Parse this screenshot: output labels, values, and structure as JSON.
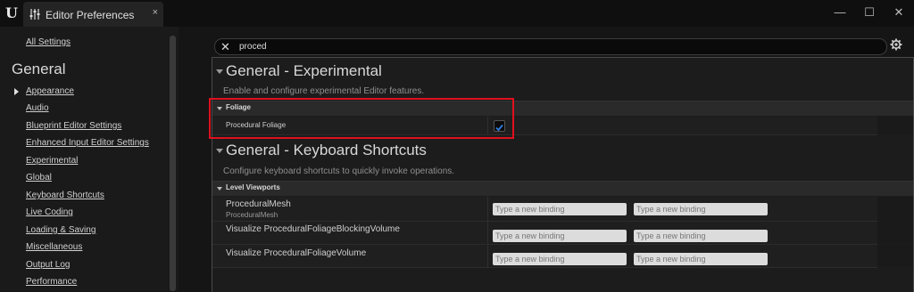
{
  "window": {
    "tab_title": "Editor Preferences",
    "tab_close": "×",
    "minimize": "—",
    "maximize": "☐",
    "close": "✕"
  },
  "sidebar": {
    "all_settings": "All Settings",
    "heading": "General",
    "items": [
      {
        "label": "Appearance",
        "active": true
      },
      {
        "label": "Audio"
      },
      {
        "label": "Blueprint Editor Settings"
      },
      {
        "label": "Enhanced Input Editor Settings"
      },
      {
        "label": "Experimental"
      },
      {
        "label": "Global"
      },
      {
        "label": "Keyboard Shortcuts"
      },
      {
        "label": "Live Coding"
      },
      {
        "label": "Loading & Saving"
      },
      {
        "label": "Miscellaneous"
      },
      {
        "label": "Output Log"
      },
      {
        "label": "Performance"
      }
    ]
  },
  "search": {
    "value": "proced",
    "clear": "✕"
  },
  "sections": {
    "experimental": {
      "title": "General - Experimental",
      "description": "Enable and configure experimental Editor features.",
      "category": "Foliage",
      "property": {
        "label": "Procedural Foliage",
        "checked": true
      }
    },
    "keyboard": {
      "title": "General - Keyboard Shortcuts",
      "description": "Configure keyboard shortcuts to quickly invoke operations.",
      "category": "Level Viewports",
      "rows": [
        {
          "label": "ProceduralMesh",
          "sub": "ProceduralMesh",
          "placeholder1": "Type a new binding",
          "placeholder2": "Type a new binding"
        },
        {
          "label": "Visualize ProceduralFoliageBlockingVolume",
          "placeholder1": "Type a new binding",
          "placeholder2": "Type a new binding"
        },
        {
          "label": "Visualize ProceduralFoliageVolume",
          "placeholder1": "Type a new binding",
          "placeholder2": "Type a new binding"
        }
      ]
    }
  },
  "colors": {
    "highlight": "#e0101e",
    "checkbox_check": "#2f7de1"
  }
}
